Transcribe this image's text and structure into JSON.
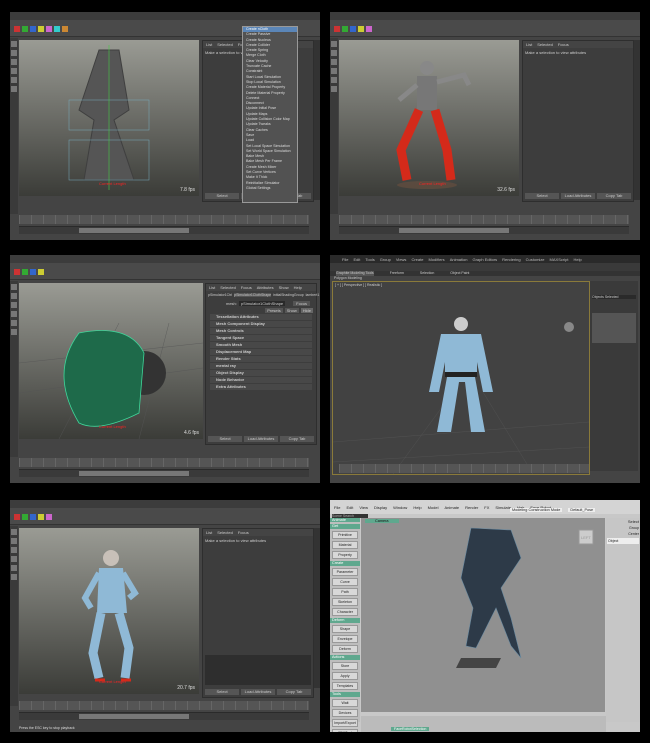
{
  "panels": [
    {
      "fps": "7.8 fps",
      "selection_label": "Current Length",
      "ae_text": "Make a selection to view attributes",
      "ae_menu": [
        "List",
        "Selected",
        "Focus",
        "Attributes",
        "Show",
        "Help"
      ],
      "ae_buttons": [
        "Select",
        "Load Attributes",
        "Copy Tab"
      ]
    },
    {
      "fps": "32.6 fps",
      "selection_label": "Current Length",
      "ae_text": "Make a selection to view attributes",
      "ae_menu": [
        "List",
        "Selected",
        "Focus",
        "Attributes",
        "Show",
        "Help"
      ],
      "ae_buttons": [
        "Select",
        "Load Attributes",
        "Copy Tab"
      ]
    },
    {
      "fps": "4.6 fps",
      "selection_label": "Current Length",
      "ae_tabs": [
        "pSimulator1Ctrl",
        "pSimulator1ClothShape",
        "initialShadingGroup",
        "lambert1"
      ],
      "mesh_label": "mesh:",
      "mesh_value": "pSimulator1ClothShape",
      "focus": "Focus",
      "presets": "Presets",
      "show": "Show",
      "hide": "Hide",
      "ae_menu": [
        "List",
        "Selected",
        "Focus",
        "Attributes",
        "Show",
        "Help"
      ],
      "sections": [
        "Tessellation Attributes",
        "Mesh Component Display",
        "Mesh Controls",
        "Tangent Space",
        "Smooth Mesh",
        "Displacement Map",
        "Render Stats",
        "mental ray",
        "Object Display",
        "Node Behavior",
        "Extra Attributes"
      ],
      "ae_buttons": [
        "Select",
        "Load Attributes",
        "Copy Tab"
      ]
    },
    {
      "menu": [
        "File",
        "Edit",
        "Tools",
        "Group",
        "Views",
        "Create",
        "Modifiers",
        "Animation",
        "Graph Editors",
        "Rendering",
        "Customize",
        "MAXScript",
        "Help"
      ],
      "ribbon": [
        "Graphite Modeling Tools",
        "Freeform",
        "Selection",
        "Object Paint"
      ],
      "sub": "Polygon Modeling",
      "viewport_label": "[ + ] [ Perspective ] [ Realistic ]",
      "cmd_field": "Objects Selected"
    },
    {
      "fps": "20.7 fps",
      "selection_label": "Current Length",
      "ae_text": "Make a selection to view attributes",
      "ae_menu": [
        "List",
        "Selected",
        "Focus",
        "Attributes",
        "Show",
        "Help"
      ],
      "ae_buttons": [
        "Select",
        "Load Attributes",
        "Copy Tab"
      ],
      "help": "Press the ESC key to stop playback"
    },
    {
      "menu": [
        "File",
        "Edit",
        "View",
        "Display",
        "Window",
        "Help",
        "Model",
        "Animate",
        "Render",
        "FX",
        "Simulate",
        "Hair",
        "Face Robot"
      ],
      "mode": "Modeling Construction Mode",
      "layout": "Default_Pose",
      "search": "Scene Search",
      "mode_tab": "Animate",
      "camera": "Camera",
      "top_right": "Select",
      "cube": "LEFT",
      "left_sections": [
        {
          "title": "Get",
          "items": [
            "Primitive",
            "Material",
            "Property"
          ]
        },
        {
          "title": "Create",
          "items": [
            "Parameter",
            "Curve",
            "Path",
            "Skeleton",
            "Character"
          ]
        },
        {
          "title": "Deform",
          "items": [
            "Shape",
            "Envelope",
            "Deform"
          ]
        },
        {
          "title": "Actions",
          "items": [
            "Store",
            "Apply",
            "Templates"
          ]
        },
        {
          "title": "Tools",
          "items": [
            "Wait",
            "Devices",
            "Import/Export",
            "FBXTool"
          ]
        }
      ],
      "right": [
        "Group",
        "Center",
        "Object"
      ],
      "bottom_label": "FaceRobotSelection"
    }
  ],
  "panel1_menu": [
    "Create nCloth",
    "Create Passive",
    "Create Nucleus",
    "Create Collider",
    "Create Spring",
    "Merge Cloth",
    "Clear Velocity",
    "Truncate Cache",
    "Constraint",
    "Start Local Simulation",
    "Stop Local Simulation",
    "Create Material Property",
    "Delete Material Property",
    "Connect",
    "Disconnect",
    "Update Initial Pose",
    "Update Maps",
    "Update Collision Color Map",
    "Update Tweaks",
    "Clear Caches",
    "Save",
    "Load",
    "Set Local Space Simulation",
    "Set World Space Simulation",
    "Bake Mesh",
    "Bake Mesh Per Frame",
    "Create Mesh Mixer",
    "Set Curve Vertices",
    "Make It Thick",
    "Reinitialize Simulator",
    "Global Settings"
  ],
  "colors": {
    "maya_bg": "#444444",
    "viewport_top": "#9a9b94",
    "viewport_bottom": "#3b3c38",
    "highlight": "#5b86b8",
    "face_robot_green": "#5fa88e",
    "cloth_green": "#3fd69a",
    "suit_red": "#d42a1a",
    "suit_blue": "#8fb9d6"
  }
}
